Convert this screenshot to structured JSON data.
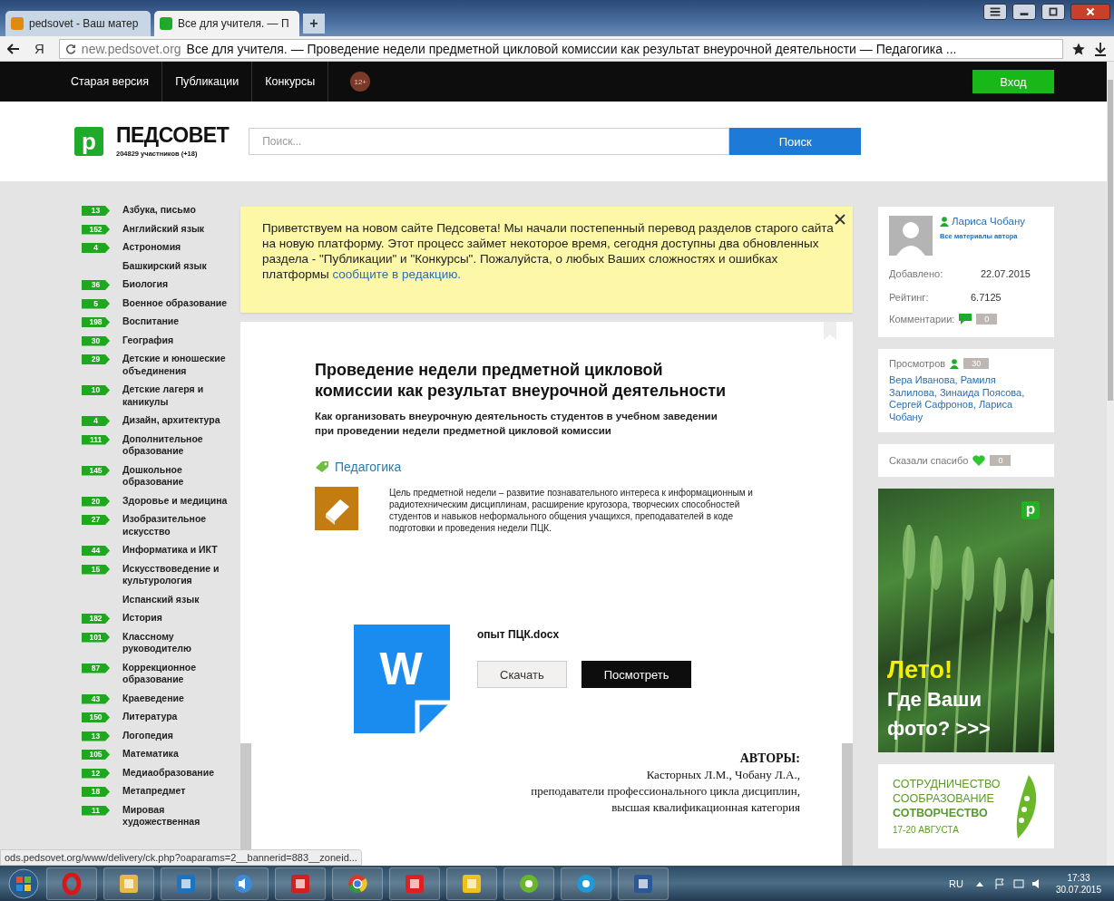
{
  "browser": {
    "tabs": [
      {
        "label": "pedsovet - Ваш матер",
        "selected": false
      },
      {
        "label": "Все для учителя. — П",
        "selected": true
      }
    ],
    "new_tab": "+",
    "yandex_button": "Я",
    "url": "new.pedsovet.org",
    "page_title": "Все для учителя. — Проведение недели предметной цикловой комиссии как результат внеурочной деятельности — Педагогика ..."
  },
  "nav": {
    "items": [
      "Старая версия",
      "Публикации",
      "Конкурсы"
    ],
    "age_badge": "12+",
    "login": "Вход"
  },
  "header": {
    "logo_mark": "p",
    "logo_text": "ПЕДСОВЕТ",
    "members": "204829 участников (+18)",
    "search": {
      "placeholder": "Поиск...",
      "button": "Поиск"
    }
  },
  "sidebar": {
    "items": [
      {
        "label": "Азбука, письмо",
        "count": "13"
      },
      {
        "label": "Английский язык",
        "count": "152"
      },
      {
        "label": "Астрономия",
        "count": "4"
      },
      {
        "label": "Башкирский язык"
      },
      {
        "label": "Биология",
        "count": "36"
      },
      {
        "label": "Военное образование",
        "count": "5"
      },
      {
        "label": "Воспитание",
        "count": "198"
      },
      {
        "label": "География",
        "count": "30"
      },
      {
        "label": "Детские и юношеские объединения",
        "count": "29"
      },
      {
        "label": "Детские лагеря и каникулы",
        "count": "10"
      },
      {
        "label": "Дизайн, архитектура",
        "count": "4"
      },
      {
        "label": "Дополнительное образование",
        "count": "111"
      },
      {
        "label": "Дошкольное образование",
        "count": "145"
      },
      {
        "label": "Здоровье и медицина",
        "count": "20"
      },
      {
        "label": "Изобразительное искусство",
        "count": "27"
      },
      {
        "label": "Информатика и ИКТ",
        "count": "44"
      },
      {
        "label": "Искусствоведение и культурология",
        "count": "15"
      },
      {
        "label": "Испанский язык"
      },
      {
        "label": "История",
        "count": "182"
      },
      {
        "label": "Классному руководителю",
        "count": "101"
      },
      {
        "label": "Коррекционное образование",
        "count": "87"
      },
      {
        "label": "Краеведение",
        "count": "43"
      },
      {
        "label": "Литература",
        "count": "150"
      },
      {
        "label": "Логопедия",
        "count": "13"
      },
      {
        "label": "Математика",
        "count": "105"
      },
      {
        "label": "Медиаобразование",
        "count": "12"
      },
      {
        "label": "Метапредмет",
        "count": "18"
      },
      {
        "label": "Мировая художественная",
        "count": "11"
      }
    ]
  },
  "notice": {
    "text": "Приветствуем на новом сайте Педсовета! Мы начали постепенный перевод разделов старого сайта на новую платформу. Этот процесс займет некоторое время, сегодня доступны два обновленных раздела - \"Публикации\" и \"Конкурсы\". Пожалуйста, о любых Ваших сложностях и ошибках платформы ",
    "link": "сообщите в редакцию."
  },
  "article": {
    "title": "Проведение недели предметной цикловой комиссии как результат внеурочной деятельности",
    "subtitle": "Как организовать внеурочную деятельность студентов в учебном заведении при проведении недели предметной цикловой комиссии",
    "tag": "Педагогика",
    "description": "Цель предметной недели – развитие познавательного интереса к информационным и радиотехническим дисциплинам, расширение кругозора, творческих способностей студентов и навыков неформального общения учащихся, преподавателей в коде подготовки и проведения недели ПЦК.",
    "file": {
      "icon_letter": "W",
      "name": "опыт ПЦК.docx",
      "buttons": [
        {
          "label": "Скачать",
          "kind": "light"
        },
        {
          "label": "Посмотреть",
          "kind": "dark"
        }
      ]
    }
  },
  "document": {
    "heading": "АВТОРЫ:",
    "lines": [
      "Касторных Л.М., Чобану Л.А.,",
      "преподаватели профессионального цикла дисциплин,",
      "высшая квалификационная категория"
    ]
  },
  "author": {
    "name": "Лариса Чобану",
    "all_materials": "Все материалы автора",
    "rows": [
      {
        "label": "Добавлено:",
        "value": "22.07.2015"
      },
      {
        "label": "Рейтинг:",
        "value": "6.7125"
      }
    ],
    "comments": {
      "label": "Комментарии:",
      "count": "0"
    }
  },
  "views": {
    "label": "Просмотров",
    "count": "30",
    "names": "Вера Иванова, Рамиля Залилова, Зинаида Поясова, Сергей Сафронов, Лариса Чобану"
  },
  "thanks": {
    "label": "Сказали спасибо",
    "count": "0"
  },
  "banner": {
    "logo_mark": "p",
    "headline": "Лето!",
    "lines": [
      "Где Ваши",
      "фото? >>>"
    ]
  },
  "ad": {
    "lines": [
      "СОТРУДНИЧЕСТВО",
      "СООБРАЗОВАНИЕ",
      "СОТВОРЧЕСТВО"
    ],
    "date": "17-20 АВГУСТА"
  },
  "status_url": "ods.pedsovet.org/www/delivery/ck.php?oaparams=2__bannerid=883__zoneid...",
  "taskbar": {
    "language": "RU",
    "time": "17:33",
    "date": "30.07.2015"
  }
}
